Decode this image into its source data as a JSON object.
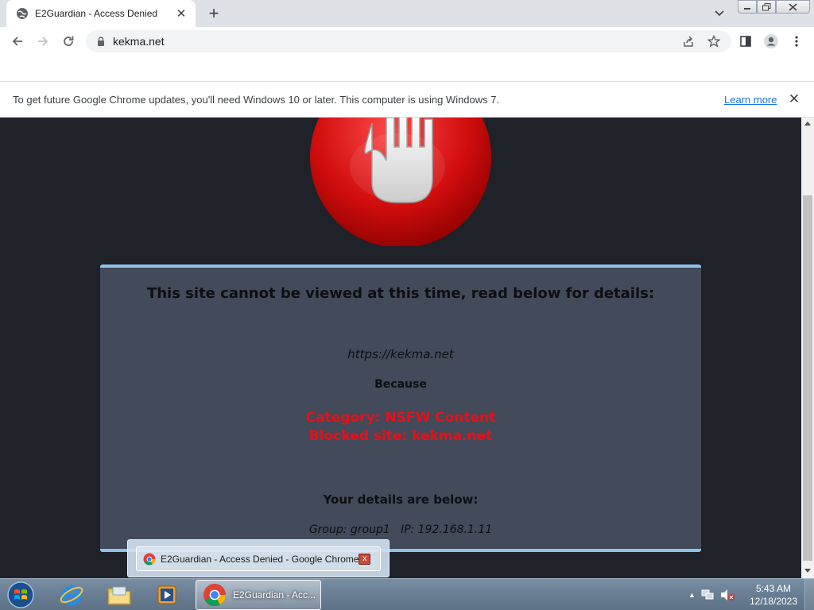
{
  "browser": {
    "tab": {
      "title": "E2Guardian - Access Denied",
      "favicon": "globe-icon",
      "close_glyph": "✕"
    },
    "newtab_glyph": "+",
    "address": {
      "url": "kekma.net"
    },
    "toolbar_icons": [
      "back-icon",
      "forward-icon",
      "reload-icon",
      "lock-icon",
      "share-icon",
      "bookmark-star-icon",
      "side-panel-icon",
      "profile-icon",
      "menu-icon"
    ]
  },
  "infobar": {
    "message": "To get future Google Chrome updates, you'll need Windows 10 or later. This computer is using Windows 7.",
    "link": "Learn more",
    "close_glyph": "✕"
  },
  "page": {
    "heading": "This site cannot be viewed at this time, read below for details:",
    "blocked_url": "https://kekma.net",
    "because": "Because",
    "reason_line1": "Category: NSFW Content",
    "reason_line2": "Blocked site: kekma.net",
    "details_heading": "Your details are below:",
    "details": "Group: group1   IP: 192.168.1.11"
  },
  "taskbar_preview": {
    "title": "E2Guardian - Access Denied - Google Chrome",
    "close_glyph": "x"
  },
  "taskbar": {
    "pinned": [
      "internet-explorer-icon",
      "file-explorer-icon",
      "media-player-icon"
    ],
    "active_app_label": "E2Guardian - Acc...",
    "clock_time": "5:43 AM",
    "clock_date": "12/18/2023",
    "tray_arrow": "▲"
  },
  "colors": {
    "panel_bg": "#434a59",
    "panel_border": "#8fc1e8",
    "reason_red": "#e8101a",
    "page_bg": "#1f2229"
  }
}
